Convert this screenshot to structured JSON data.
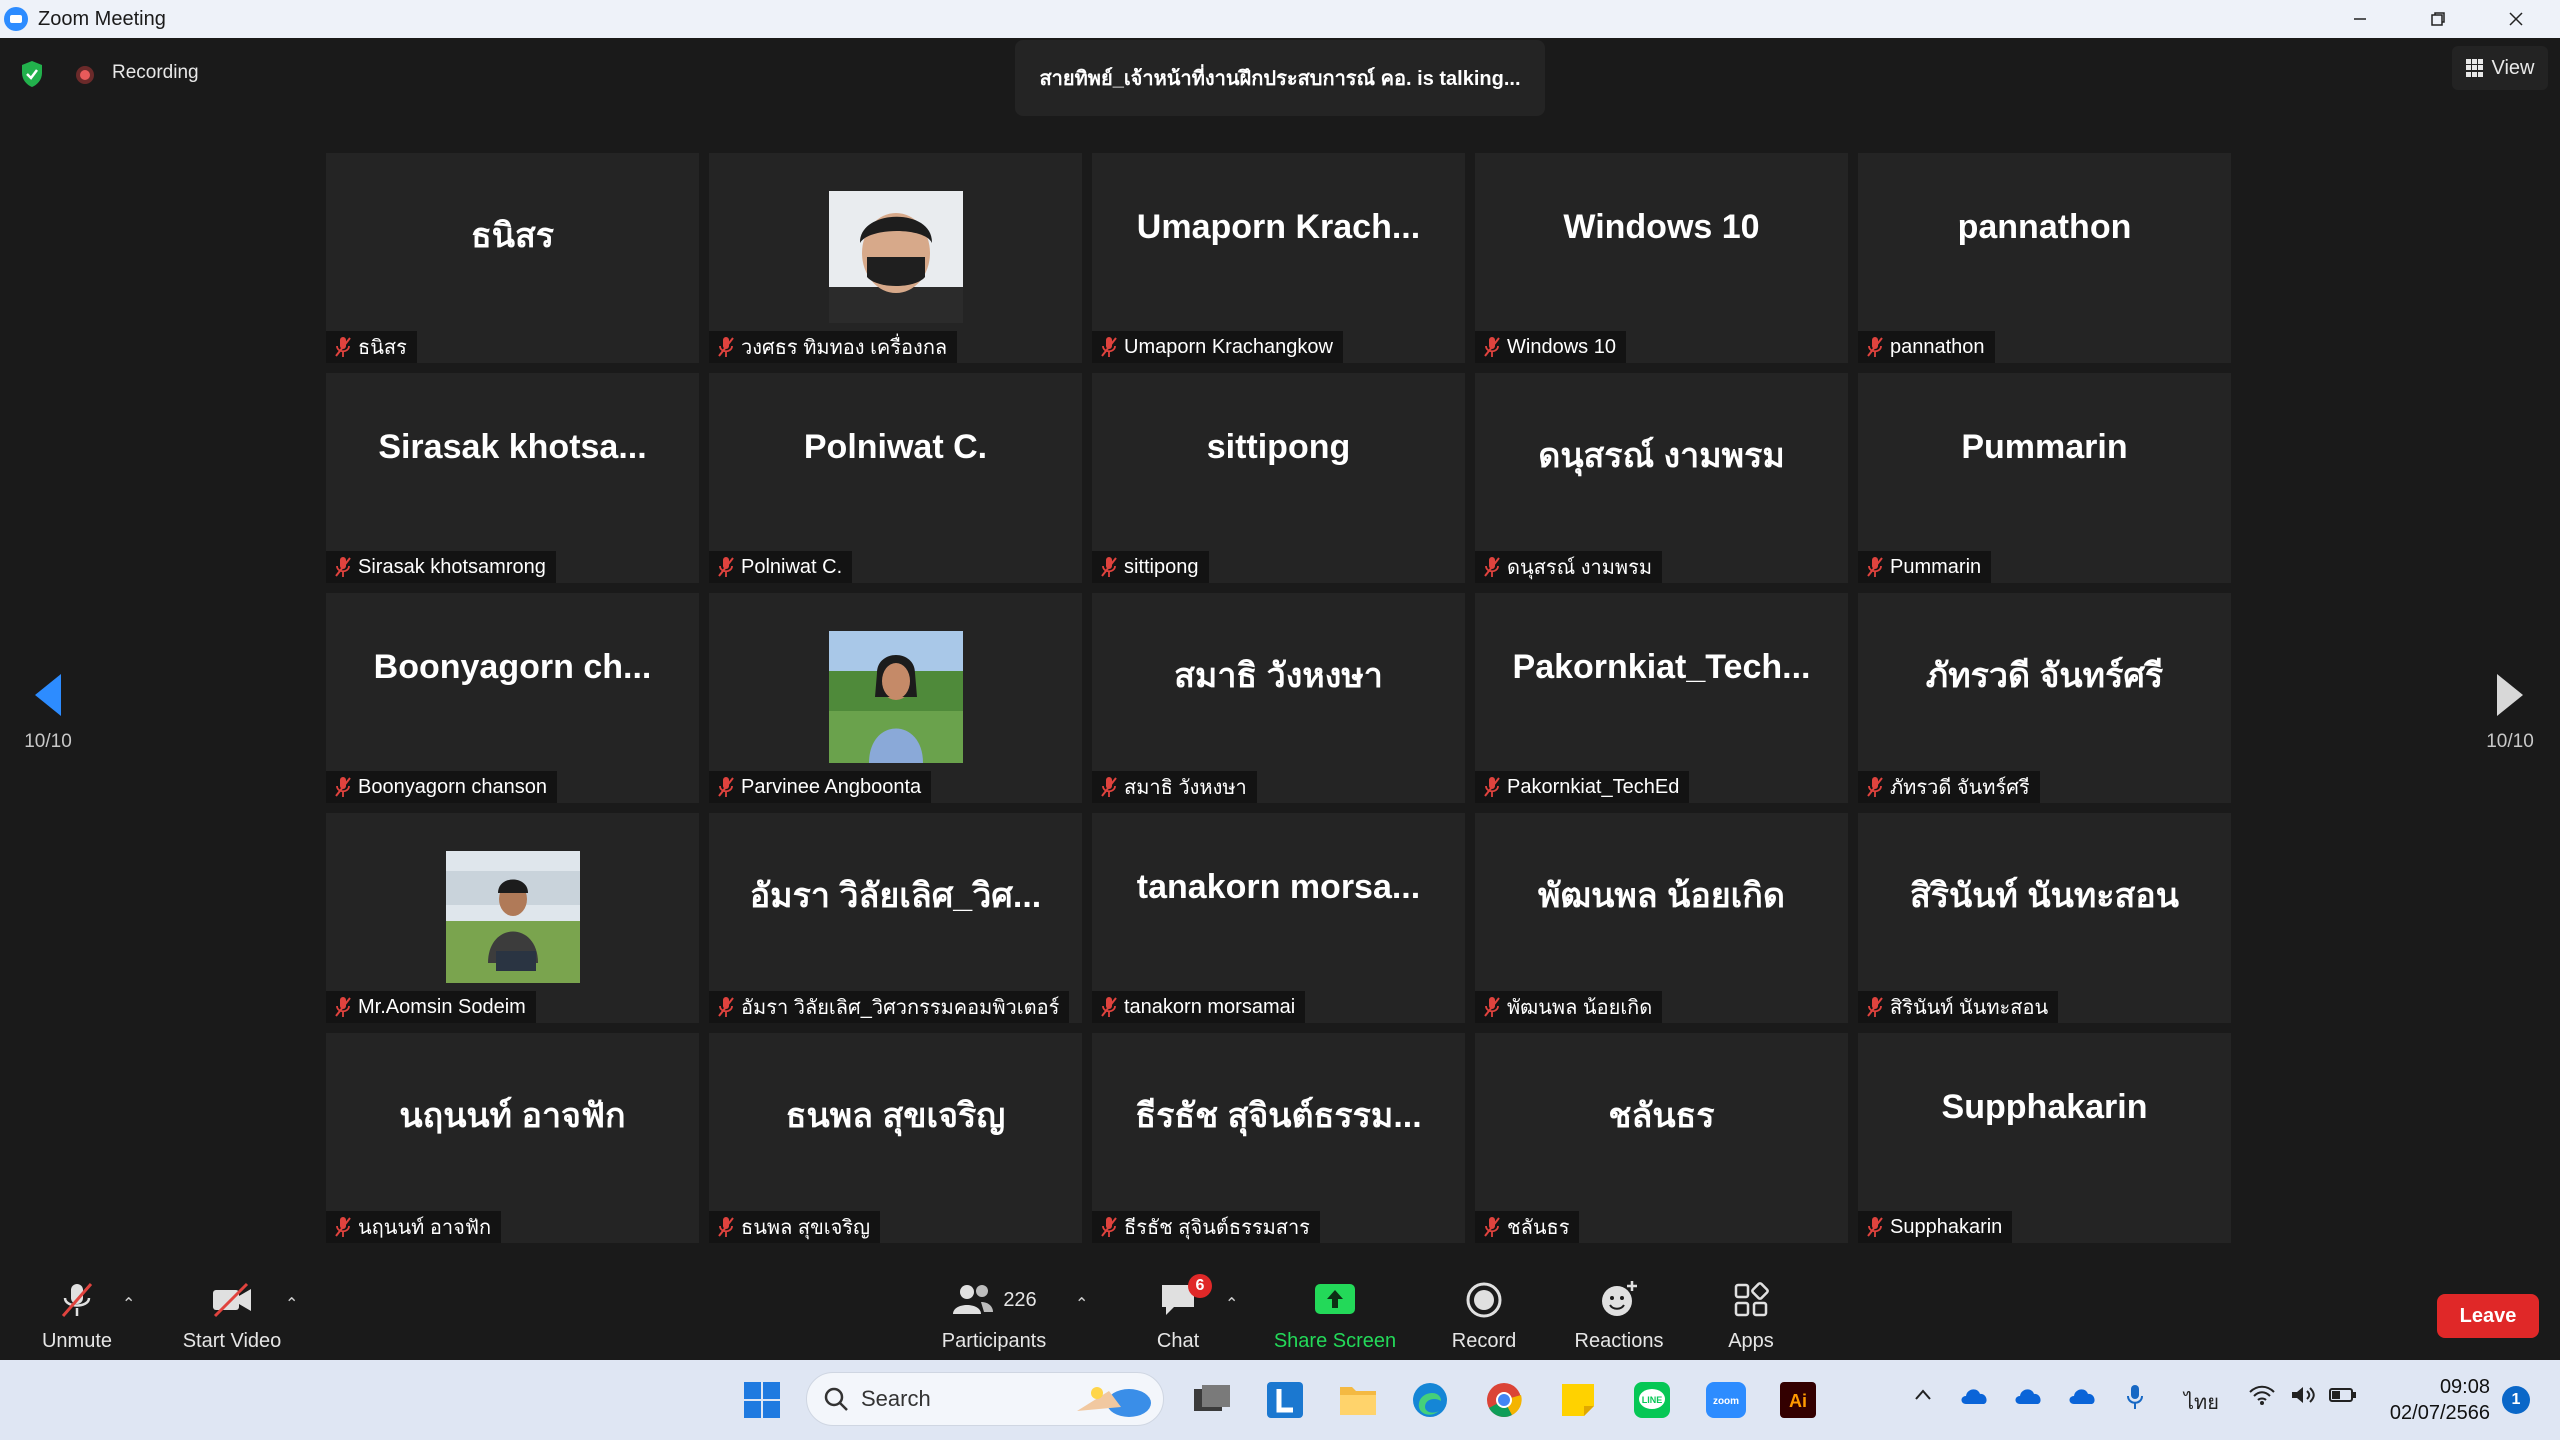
{
  "window": {
    "title": "Zoom Meeting"
  },
  "topbar": {
    "recording_label": "Recording",
    "talking_banner": "สายทิพย์_เจ้าหน้าที่งานฝึกประสบการณ์ คอ. is talking...",
    "view_label": "View"
  },
  "participants": [
    {
      "display": "ธนิสร",
      "name": "ธนิสร",
      "video": false
    },
    {
      "display": "",
      "name": "วงศธร ทิมทอง เครื่องกล",
      "video": true
    },
    {
      "display": "Umaporn  Krach...",
      "name": "Umaporn Krachangkow",
      "video": false
    },
    {
      "display": "Windows 10",
      "name": "Windows 10",
      "video": false
    },
    {
      "display": "pannathon",
      "name": "pannathon",
      "video": false
    },
    {
      "display": "Sirasak  khotsa...",
      "name": "Sirasak khotsamrong",
      "video": false
    },
    {
      "display": "Polniwat C.",
      "name": "Polniwat C.",
      "video": false
    },
    {
      "display": "sittipong",
      "name": "sittipong",
      "video": false
    },
    {
      "display": "ดนุสรณ์ งามพรม",
      "name": "ดนุสรณ์ งามพรม",
      "video": false
    },
    {
      "display": "Pummarin",
      "name": "Pummarin",
      "video": false
    },
    {
      "display": "Boonyagorn  ch...",
      "name": "Boonyagorn chanson",
      "video": false
    },
    {
      "display": "",
      "name": "Parvinee Angboonta",
      "video": true
    },
    {
      "display": "สมาธิ วังหงษา",
      "name": "สมาธิ วังหงษา",
      "video": false
    },
    {
      "display": "Pakornkiat_Tech...",
      "name": "Pakornkiat_TechEd",
      "video": false
    },
    {
      "display": "ภัทรวดี จันทร์ศรี",
      "name": "ภัทรวดี จันทร์ศรี",
      "video": false
    },
    {
      "display": "",
      "name": "Mr.Aomsin Sodeim",
      "video": true
    },
    {
      "display": "อัมรา วิลัยเลิศ_วิศ...",
      "name": "อัมรา วิลัยเลิศ_วิศวกรรมคอมพิวเตอร์",
      "video": false
    },
    {
      "display": "tanakorn  morsa...",
      "name": "tanakorn morsamai",
      "video": false
    },
    {
      "display": "พัฒนพล น้อยเกิด",
      "name": "พัฒนพล น้อยเกิด",
      "video": false
    },
    {
      "display": "สิรินันท์ นันทะสอน",
      "name": "สิรินันท์ นันทะสอน",
      "video": false
    },
    {
      "display": "นฤนนท์ อาจฟัก",
      "name": "นฤนนท์ อาจฟัก",
      "video": false
    },
    {
      "display": "ธนพล สุขเจริญ",
      "name": "ธนพล สุขเจริญ",
      "video": false
    },
    {
      "display": "ธีรธัช สุจินต์ธรรม...",
      "name": "ธีรธัช สุจินต์ธรรมสาร",
      "video": false
    },
    {
      "display": "ชลันธร",
      "name": "ชลันธร",
      "video": false
    },
    {
      "display": "Supphakarin",
      "name": "Supphakarin",
      "video": false
    }
  ],
  "nav": {
    "left_page": "10/10",
    "right_page": "10/10"
  },
  "toolbar": {
    "unmute": "Unmute",
    "start_video": "Start Video",
    "participants_count": "226",
    "participants": "Participants",
    "chat": "Chat",
    "chat_badge": "6",
    "share_screen": "Share Screen",
    "record": "Record",
    "reactions": "Reactions",
    "apps": "Apps",
    "leave": "Leave"
  },
  "taskbar": {
    "search": "Search",
    "language": "ไทย",
    "time": "09:08",
    "date": "02/07/2566",
    "notification_count": "1"
  },
  "colors": {
    "background": "#1a1a1a",
    "tile": "#242424",
    "leave": "#e02828",
    "share_screen": "#23d959",
    "muted_icon": "#e0433e"
  }
}
